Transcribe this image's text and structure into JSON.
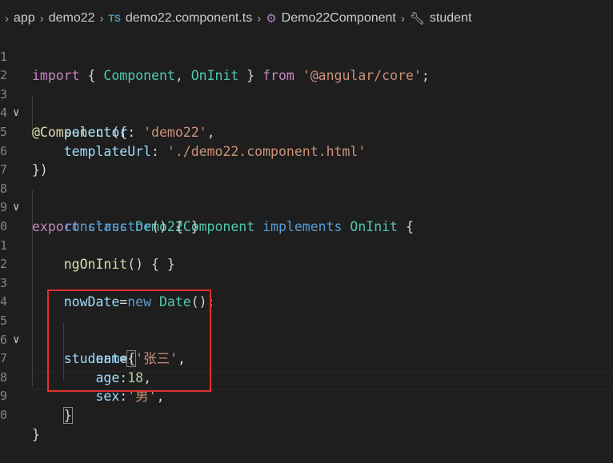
{
  "breadcrumb": {
    "items": [
      "app",
      "demo22",
      "demo22.component.ts",
      "Demo22Component",
      "student"
    ],
    "ts_badge": "TS"
  },
  "code_lines": [
    {
      "n": "1"
    },
    {
      "n": "2"
    },
    {
      "n": "3"
    },
    {
      "n": "4"
    },
    {
      "n": "5"
    },
    {
      "n": "6"
    },
    {
      "n": "7"
    },
    {
      "n": "8"
    },
    {
      "n": "9"
    },
    {
      "n": "0"
    },
    {
      "n": "1"
    },
    {
      "n": "2"
    },
    {
      "n": "3"
    },
    {
      "n": "4"
    },
    {
      "n": "5"
    },
    {
      "n": "6"
    },
    {
      "n": "7"
    },
    {
      "n": "8"
    },
    {
      "n": "9"
    },
    {
      "n": "0"
    }
  ],
  "tokens": {
    "import": "import",
    "component": "Component",
    "oninit": "OnInit",
    "from": "from",
    "module": "'@angular/core'",
    "decorator": "@Component",
    "selector_key": "selector",
    "selector_val": "'demo22'",
    "templateUrl_key": "templateUrl",
    "templateUrl_val": "'./demo22.component.html'",
    "export": "export",
    "class": "class",
    "classname": "Demo22Component",
    "implements": "implements",
    "constructor": "constructor",
    "ngOnInit": "ngOnInit",
    "nowDate": "nowDate",
    "new": "new",
    "Date": "Date",
    "student": "student",
    "name_key": "name",
    "name_val": "'张三'",
    "age_key": "age",
    "age_val": "18",
    "sex_key": "sex",
    "sex_val": "'男'"
  },
  "colors": {
    "background": "#1e1e1e",
    "keyword": "#569cd6",
    "control": "#c586c0",
    "string": "#ce9178",
    "type": "#4ec9b0",
    "property": "#9cdcfe",
    "function": "#dcdcaa",
    "number": "#b5cea8",
    "highlight_box": "#e03131"
  }
}
